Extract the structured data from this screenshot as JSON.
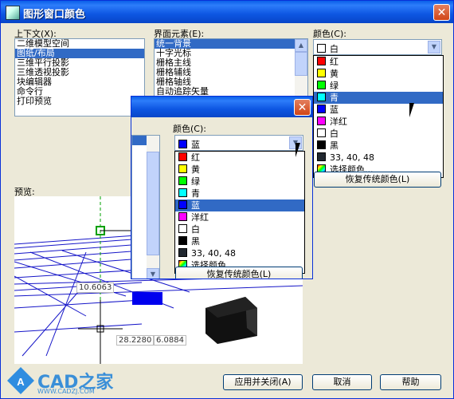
{
  "window": {
    "title": "图形窗口颜色"
  },
  "labels": {
    "context": "上下文(X):",
    "element": "界面元素(E):",
    "color": "颜色(C):",
    "preview": "预览:",
    "sub_color": "颜色(C):"
  },
  "context_list": [
    "二维模型空间",
    "图纸/布局",
    "三维平行投影",
    "三维透视投影",
    "块编辑器",
    "命令行",
    "打印预览"
  ],
  "element_list": [
    "统一背景",
    "十字光标",
    "栅格主线",
    "栅格辅线",
    "栅格轴线",
    "自动追踪矢量"
  ],
  "main_combo": {
    "value": "白"
  },
  "main_colors": [
    {
      "label": "红",
      "color": "#ff0000"
    },
    {
      "label": "黄",
      "color": "#ffff00"
    },
    {
      "label": "绿",
      "color": "#00ff00"
    },
    {
      "label": "青",
      "color": "#00ffff"
    },
    {
      "label": "蓝",
      "color": "#0000ff"
    },
    {
      "label": "洋红",
      "color": "#ff00ff"
    },
    {
      "label": "白",
      "color": "#ffffff"
    },
    {
      "label": "黑",
      "color": "#000000"
    },
    {
      "label": "33, 40, 48",
      "color": "#212830"
    },
    {
      "label": "选择颜色...",
      "color": "#ffffff"
    }
  ],
  "main_restore_button": "恢复传统颜色(L)",
  "sub_combo": {
    "value": "蓝"
  },
  "sub_colors": [
    {
      "label": "红",
      "color": "#ff0000"
    },
    {
      "label": "黄",
      "color": "#ffff00"
    },
    {
      "label": "绿",
      "color": "#00ff00"
    },
    {
      "label": "青",
      "color": "#00ffff"
    },
    {
      "label": "蓝",
      "color": "#0000ff"
    },
    {
      "label": "洋红",
      "color": "#ff00ff"
    },
    {
      "label": "白",
      "color": "#ffffff"
    },
    {
      "label": "黑",
      "color": "#000000"
    },
    {
      "label": "33, 40, 48",
      "color": "#212830"
    },
    {
      "label": "选择颜色...",
      "color": "#ffffff"
    }
  ],
  "sub_restore_button": "恢复传统颜色(L)",
  "preview": {
    "dim1": "10.6063",
    "dim2": "28.2280",
    "dim3": "6.0884"
  },
  "buttons": {
    "apply_close": "应用并关闭(A)",
    "cancel": "取消",
    "help": "帮助"
  },
  "watermark": {
    "brand": "CAD之家",
    "url": "WWW.CADZJ.COM"
  },
  "colors": {
    "title_blue": "#0a5fe8",
    "selection": "#316ac5",
    "dialog_bg": "#ece9d8",
    "grid": "#1515c8"
  }
}
